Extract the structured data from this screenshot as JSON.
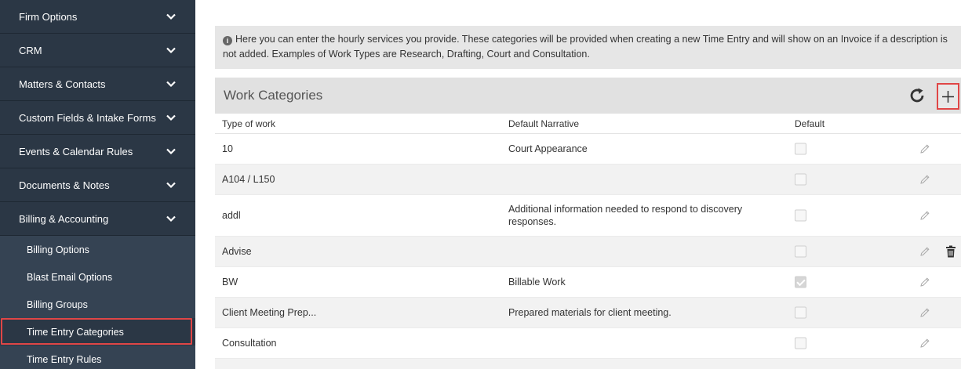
{
  "sidebar": {
    "sections": [
      {
        "label": "Firm Options"
      },
      {
        "label": "CRM"
      },
      {
        "label": "Matters & Contacts"
      },
      {
        "label": "Custom Fields & Intake Forms"
      },
      {
        "label": "Events & Calendar Rules"
      },
      {
        "label": "Documents & Notes"
      },
      {
        "label": "Billing & Accounting"
      }
    ],
    "billing_items": [
      {
        "label": "Billing Options"
      },
      {
        "label": "Blast Email Options"
      },
      {
        "label": "Billing Groups"
      },
      {
        "label": "Time Entry Categories"
      },
      {
        "label": "Time Entry Rules"
      }
    ]
  },
  "info": {
    "icon": "info-circle-icon",
    "text": "Here you can enter the hourly services you provide. These categories will be provided when creating a new Time Entry and will show on an Invoice if a description is not added. Examples of Work Types are Research, Drafting, Court and Consultation."
  },
  "panel": {
    "title": "Work Categories",
    "columns": {
      "type": "Type of work",
      "narrative": "Default Narrative",
      "default": "Default"
    },
    "rows": [
      {
        "type": "10",
        "narrative": "Court Appearance",
        "default": false
      },
      {
        "type": "A104 / L150",
        "narrative": "",
        "default": false
      },
      {
        "type": "addl",
        "narrative": "Additional information needed to respond to discovery responses.",
        "default": false
      },
      {
        "type": "Advise",
        "narrative": "",
        "default": false
      },
      {
        "type": "BW",
        "narrative": "Billable Work",
        "default": true
      },
      {
        "type": "Client Meeting Prep...",
        "narrative": "Prepared materials for client meeting.",
        "default": false
      },
      {
        "type": "Consultation",
        "narrative": "",
        "default": false
      }
    ]
  },
  "colors": {
    "sidebar_bg": "#2b3745",
    "sidebar_sub_bg": "#354353",
    "highlight": "#e04646",
    "panel_header_bg": "#e1e1e1"
  }
}
